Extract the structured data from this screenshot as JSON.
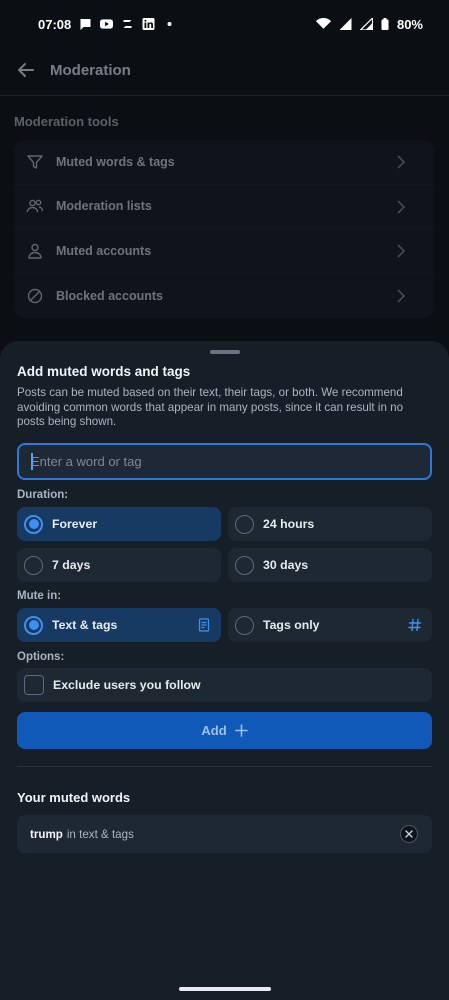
{
  "status_bar": {
    "time": "07:08",
    "battery": "80%",
    "notification_icons": [
      "message-icon",
      "youtube-icon",
      "zcash-icon",
      "linkedin-icon",
      "dot-icon"
    ],
    "system_icons": [
      "wifi-icon",
      "signal-icon",
      "signal-icon",
      "battery-icon"
    ]
  },
  "header": {
    "title": "Moderation"
  },
  "moderation_tools": {
    "section_title": "Moderation tools",
    "items": [
      {
        "label": "Muted words & tags",
        "icon": "filter-icon"
      },
      {
        "label": "Moderation lists",
        "icon": "people-icon"
      },
      {
        "label": "Muted accounts",
        "icon": "person-icon"
      },
      {
        "label": "Blocked accounts",
        "icon": "block-icon"
      }
    ]
  },
  "sheet": {
    "title": "Add muted words and tags",
    "description": "Posts can be muted based on their text, their tags, or both. We recommend avoiding common words that appear in many posts, since it can result in no posts being shown.",
    "input_placeholder": "Enter a word or tag",
    "input_value": "",
    "duration_label": "Duration:",
    "duration_options": [
      {
        "label": "Forever",
        "selected": true
      },
      {
        "label": "24 hours",
        "selected": false
      },
      {
        "label": "7 days",
        "selected": false
      },
      {
        "label": "30 days",
        "selected": false
      }
    ],
    "mute_in_label": "Mute in:",
    "mute_in_options": [
      {
        "label": "Text & tags",
        "selected": true,
        "icon": "document-icon"
      },
      {
        "label": "Tags only",
        "selected": false,
        "icon": "hash-icon"
      }
    ],
    "options_label": "Options:",
    "exclude_following_label": "Exclude users you follow",
    "exclude_following_checked": false,
    "add_button_label": "Add",
    "muted_words_title": "Your muted words",
    "muted_words": [
      {
        "word": "trump",
        "context": "in text & tags"
      }
    ]
  },
  "colors": {
    "background": "#0b0f14",
    "sheet": "#161e28",
    "accent": "#1059b8",
    "selected_option": "#173a63",
    "radio_selected": "#3f8fee"
  }
}
